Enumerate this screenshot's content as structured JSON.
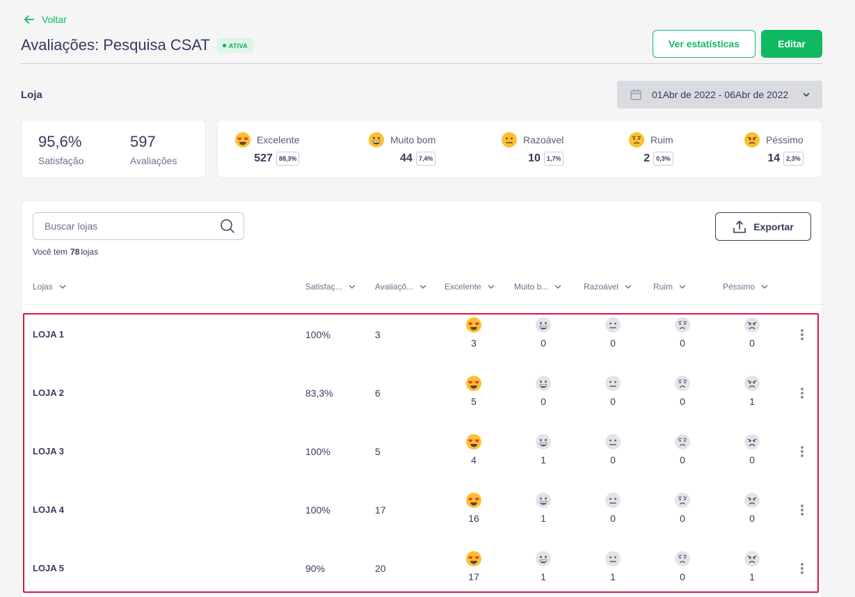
{
  "back_label": "Voltar",
  "page_title": "Avaliações: Pesquisa CSAT",
  "status_badge": "ATIVA",
  "buttons": {
    "stats": "Ver estatísticas",
    "edit": "Editar",
    "export": "Exportar"
  },
  "section_label": "Loja",
  "date_range": "01Abr de 2022 - 06Abr de 2022",
  "summary": {
    "satisfaction_value": "95,6%",
    "satisfaction_label": "Satisfação",
    "reviews_value": "597",
    "reviews_label": "Avaliações"
  },
  "ratings": [
    {
      "label": "Excelente",
      "count": "527",
      "pct": "88,3%"
    },
    {
      "label": "Muito bom",
      "count": "44",
      "pct": "7,4%"
    },
    {
      "label": "Razoável",
      "count": "10",
      "pct": "1,7%"
    },
    {
      "label": "Ruim",
      "count": "2",
      "pct": "0,3%"
    },
    {
      "label": "Péssimo",
      "count": "14",
      "pct": "2,3%"
    }
  ],
  "search": {
    "placeholder": "Buscar lojas"
  },
  "store_count": {
    "prefix": "Você tem",
    "value": "78",
    "suffix": "lojas"
  },
  "table": {
    "headers": [
      "Lojas",
      "Satisfaç...",
      "Avaliaçõ...",
      "Excelente",
      "Muito b...",
      "Razoável",
      "Ruim",
      "Péssimo"
    ],
    "rows": [
      {
        "name": "LOJA 1",
        "satisfaction": "100%",
        "reviews": "3",
        "excellent": "3",
        "very_good": "0",
        "reasonable": "0",
        "bad": "0",
        "terrible": "0"
      },
      {
        "name": "LOJA 2",
        "satisfaction": "83,3%",
        "reviews": "6",
        "excellent": "5",
        "very_good": "0",
        "reasonable": "0",
        "bad": "0",
        "terrible": "1"
      },
      {
        "name": "LOJA 3",
        "satisfaction": "100%",
        "reviews": "5",
        "excellent": "4",
        "very_good": "1",
        "reasonable": "0",
        "bad": "0",
        "terrible": "0"
      },
      {
        "name": "LOJA 4",
        "satisfaction": "100%",
        "reviews": "17",
        "excellent": "16",
        "very_good": "1",
        "reasonable": "0",
        "bad": "0",
        "terrible": "0"
      },
      {
        "name": "LOJA 5",
        "satisfaction": "90%",
        "reviews": "20",
        "excellent": "17",
        "very_good": "1",
        "reasonable": "1",
        "bad": "0",
        "terrible": "1"
      }
    ]
  },
  "colors": {
    "accent": "#0fb95f",
    "text": "#343b5e",
    "highlight": "#e0123b",
    "emoji_yellow": "#fbc02d"
  }
}
